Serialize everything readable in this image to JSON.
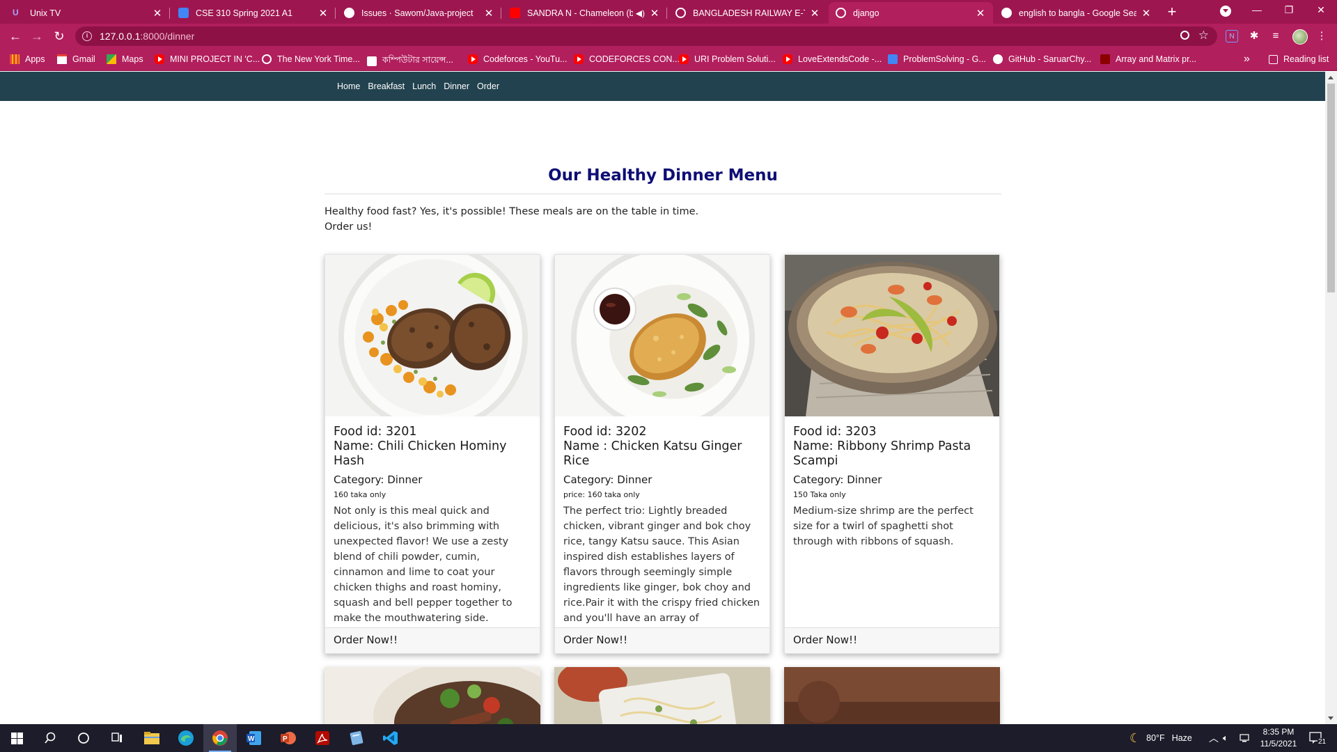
{
  "browser": {
    "tabs": [
      {
        "title": "Unix TV",
        "favicon": "unix-tv-icon",
        "favicon_color": "#5b4fd6"
      },
      {
        "title": "CSE 310 Spring 2021 A1",
        "favicon": "classroom-icon",
        "favicon_color": "#4285f4"
      },
      {
        "title": "Issues · Sawom/Java-project",
        "favicon": "github-icon",
        "favicon_color": "#ffffff"
      },
      {
        "title": "SANDRA N - Chameleon (by",
        "favicon": "youtube-icon",
        "favicon_color": "#ff0000",
        "audio": true
      },
      {
        "title": "BANGLADESH RAILWAY E-TICKE",
        "favicon": "globe-icon",
        "favicon_color": "#ffffff"
      },
      {
        "title": "django",
        "favicon": "globe-icon",
        "favicon_color": "#ffffff",
        "active": true
      },
      {
        "title": "english to bangla - Google Searc",
        "favicon": "google-icon",
        "favicon_color": "#ffffff"
      }
    ],
    "url_host": "127.0.0.1",
    "url_path": ":8000/dinner",
    "bookmarks": [
      {
        "label": "Apps",
        "icon": "apps"
      },
      {
        "label": "Gmail",
        "icon": "gmail"
      },
      {
        "label": "Maps",
        "icon": "maps"
      },
      {
        "label": "MINI PROJECT IN 'C...",
        "icon": "yt"
      },
      {
        "label": "The New York Time...",
        "icon": "globe"
      },
      {
        "label": "কম্পিউটার সায়েন্স...",
        "icon": "kb"
      },
      {
        "label": "Codeforces - YouTu...",
        "icon": "yt"
      },
      {
        "label": "CODEFORCES CON...",
        "icon": "yt"
      },
      {
        "label": "URI Problem Soluti...",
        "icon": "yt"
      },
      {
        "label": "LoveExtendsCode -...",
        "icon": "yt"
      },
      {
        "label": "ProblemSolving - G...",
        "icon": "doc"
      },
      {
        "label": "GitHub - SaruarChy...",
        "icon": "gh"
      },
      {
        "label": "Array and Matrix pr...",
        "icon": "arr"
      }
    ],
    "bookmarks_more": "»",
    "reading_list": "Reading list"
  },
  "site": {
    "nav": [
      "Home",
      "Breakfast",
      "Lunch",
      "Dinner",
      "Order"
    ],
    "heading": "Our Healthy Dinner Menu",
    "intro_line1": "Healthy food fast? Yes, it's possible! These meals are on the table in time.",
    "intro_line2": "Order us!",
    "cards": [
      {
        "id": "Food id: 3201",
        "name": "Name: Chili Chicken Hominy Hash",
        "category": "Category: Dinner",
        "price": "160 taka only",
        "description": "Not only is this meal quick and delicious, it's also brimming with unexpected flavor! We use a zesty blend of chili powder, cumin, cinnamon and lime to coat your chicken thighs and roast hominy, squash and bell pepper together to make the mouthwatering side.",
        "cta": "Order Now!!"
      },
      {
        "id": "Food id: 3202",
        "name": "Name : Chicken Katsu Ginger Rice",
        "category": "Category: Dinner",
        "price": "price: 160 taka only",
        "description": "The perfect trio: Lightly breaded chicken, vibrant ginger and bok choy rice, tangy Katsu sauce. This Asian inspired dish establishes layers of flavors through seemingly simple ingredients like ginger, bok choy and rice.Pair it with the crispy fried chicken and you'll have an array of unparalleled flavors and textures.",
        "cta": "Order Now!!"
      },
      {
        "id": "Food id: 3203",
        "name": "Name: Ribbony Shrimp Pasta Scampi",
        "category": "Category: Dinner",
        "price": "150 Taka only",
        "description": "Medium-size shrimp are the perfect size for a twirl of spaghetti shot through with ribbons of squash.",
        "cta": "Order Now!!"
      }
    ]
  },
  "taskbar": {
    "weather_temp": "80°F",
    "weather_desc": "Haze",
    "time": "8:35 PM",
    "date": "11/5/2021",
    "notif_count": "21"
  },
  "colors": {
    "chrome_frame": "#9e1650",
    "chrome_toolbar": "#b21f5d",
    "site_nav": "#22424f",
    "heading": "#0e0e75"
  }
}
